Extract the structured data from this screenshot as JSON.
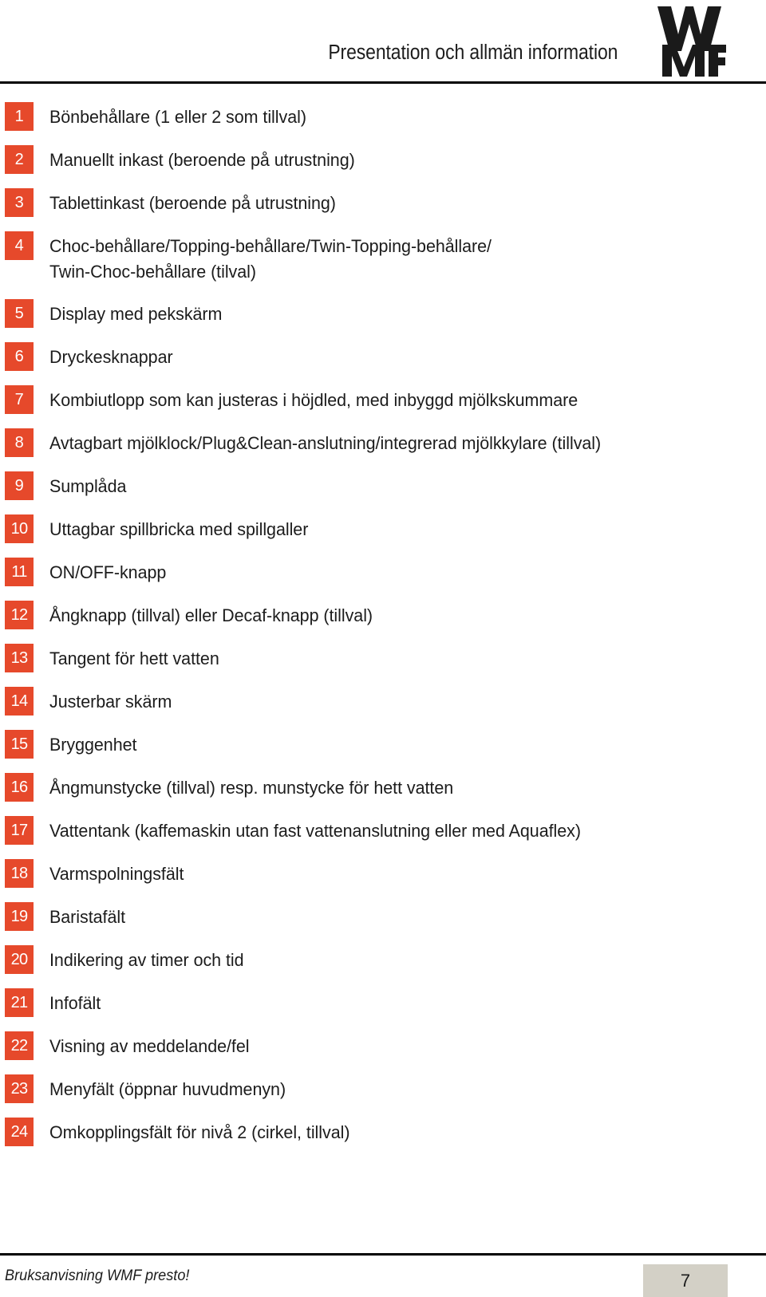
{
  "header": {
    "title": "Presentation och allmän information",
    "logo_alt": "WMF"
  },
  "list": {
    "items": [
      {
        "number": "1",
        "text": "Bönbehållare (1 eller 2 som tillval)"
      },
      {
        "number": "2",
        "text": "Manuellt inkast (beroende på utrustning)"
      },
      {
        "number": "3",
        "text": "Tablettinkast (beroende på utrustning)"
      },
      {
        "number": "4",
        "text": "Choc-behållare/Topping-behållare/Twin-Topping-behållare/\nTwin-Choc-behållare (tilval)"
      },
      {
        "number": "5",
        "text": "Display med pekskärm"
      },
      {
        "number": "6",
        "text": "Dryckesknappar"
      },
      {
        "number": "7",
        "text": "Kombiutlopp som kan justeras i höjdled, med inbyggd mjölkskummare"
      },
      {
        "number": "8",
        "text": "Avtagbart mjölklock/Plug&Clean-anslutning/integrerad mjölkkylare (tillval)"
      },
      {
        "number": "9",
        "text": "Sumplåda"
      },
      {
        "number": "10",
        "text": "Uttagbar spillbricka med spillgaller"
      },
      {
        "number": "11",
        "text": "ON/OFF-knapp"
      },
      {
        "number": "12",
        "text": "Ångknapp (tillval) eller Decaf-knapp (tillval)"
      },
      {
        "number": "13",
        "text": "Tangent för hett vatten"
      },
      {
        "number": "14",
        "text": "Justerbar skärm"
      },
      {
        "number": "15",
        "text": "Bryggenhet"
      },
      {
        "number": "16",
        "text": "Ångmunstycke (tillval) resp. munstycke för hett vatten"
      },
      {
        "number": "17",
        "text": "Vattentank (kaffemaskin utan fast vattenanslutning eller med Aquaflex)"
      },
      {
        "number": "18",
        "text": "Varmspolningsfält"
      },
      {
        "number": "19",
        "text": "Baristafält"
      },
      {
        "number": "20",
        "text": "Indikering av timer och tid"
      },
      {
        "number": "21",
        "text": "Infofält"
      },
      {
        "number": "22",
        "text": "Visning av meddelande/fel"
      },
      {
        "number": "23",
        "text": "Menyfält (öppnar huvudmenyn)"
      },
      {
        "number": "24",
        "text": "Omkopplingsfält för nivå 2 (cirkel, tillval)"
      }
    ]
  },
  "footer": {
    "note": "Bruksanvisning WMF presto!",
    "page_number": "7"
  },
  "colors": {
    "badge_orange": "#E6492B",
    "page_box": "#D3D0C6",
    "rule": "#000000",
    "text": "#1c1c1c"
  }
}
